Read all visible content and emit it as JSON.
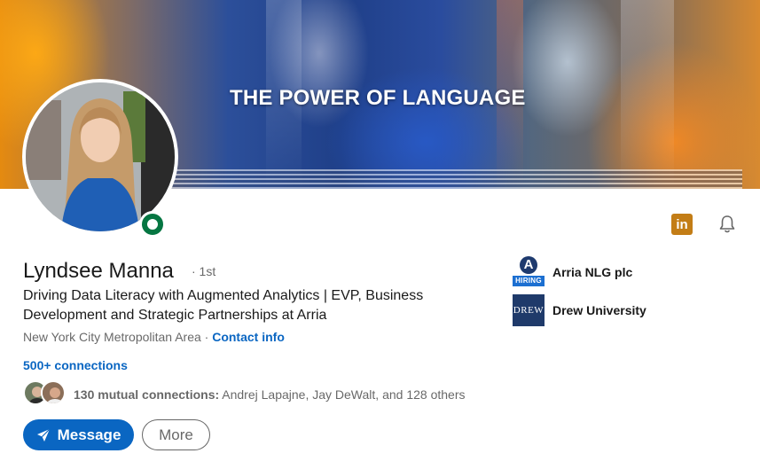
{
  "cover": {
    "title": "THE POWER OF LANGUAGE"
  },
  "profile": {
    "name": "Lyndsee Manna",
    "degree": "· 1st",
    "headline": "Driving Data Literacy with Augmented Analytics | EVP, Business Development and Strategic Partnerships at Arria",
    "location": "New York City Metropolitan Area",
    "location_separator": " · ",
    "contact_info": "Contact info",
    "connections": "500+ connections",
    "status": "online"
  },
  "mutual": {
    "count_label": "130 mutual connections:",
    "names": " Andrej Lapajne, Jay DeWalt, and 128 others"
  },
  "actions": {
    "message_label": "Message",
    "more_label": "More"
  },
  "icons": {
    "linkedin_badge": "linkedin-icon",
    "bell": "bell-icon",
    "message": "paper-plane-icon"
  },
  "organizations": [
    {
      "name": "Arria NLG plc",
      "logo_letter": "A",
      "logo_badge": "HIRING"
    },
    {
      "name": "Drew University",
      "logo_text": "DREW"
    }
  ],
  "colors": {
    "primary": "#0a66c2",
    "online": "#057642",
    "linkedin_badge": "#c37d16",
    "drew_logo": "#1f3a6a"
  }
}
